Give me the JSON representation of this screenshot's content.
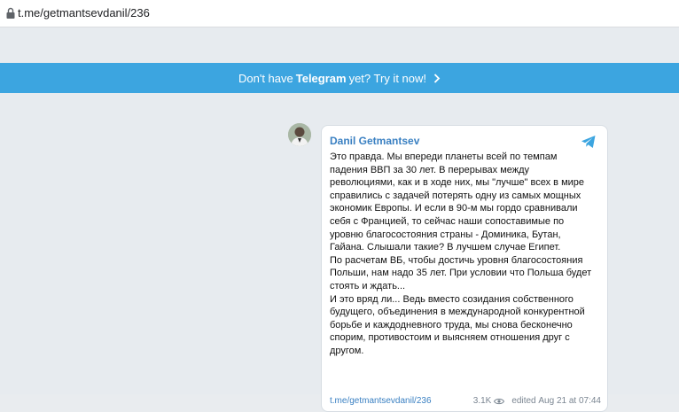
{
  "browser": {
    "url": "t.me/getmantsevdanil/236"
  },
  "banner": {
    "prefix": "Don't have",
    "brand": "Telegram",
    "suffix": "yet? Try it now!"
  },
  "post": {
    "author": "Danil Getmantsev",
    "paragraphs": [
      "Это правда. Мы впереди планеты всей по темпам падения ВВП за 30 лет. В перерывах между революциями, как и в ходе них, мы \"лучше\" всех в мире справились с задачей потерять одну из самых мощных экономик Европы. И если в 90-м мы гордо сравнивали себя с Францией, то сейчас наши сопоставимые по уровню благосостояния страны - Доминика, Бутан, Гайана. Слышали такие? В лучшем случае Египет.",
      "По расчетам ВБ, чтобы достичь уровня благосостояния Польши, нам надо 35 лет. При условии что Польша будет стоять и ждать...",
      "И это вряд ли... Ведь вместо созидания собственного будущего, объединения в международной конкурентной борьбе и каждодневного труда, мы снова бесконечно спорим, противостоим и выясняем отношения друг с другом."
    ],
    "footer": {
      "link": "t.me/getmantsevdanil/236",
      "views": "3.1K",
      "edited_label": "edited",
      "date": "Aug 21 at 07:44"
    }
  }
}
